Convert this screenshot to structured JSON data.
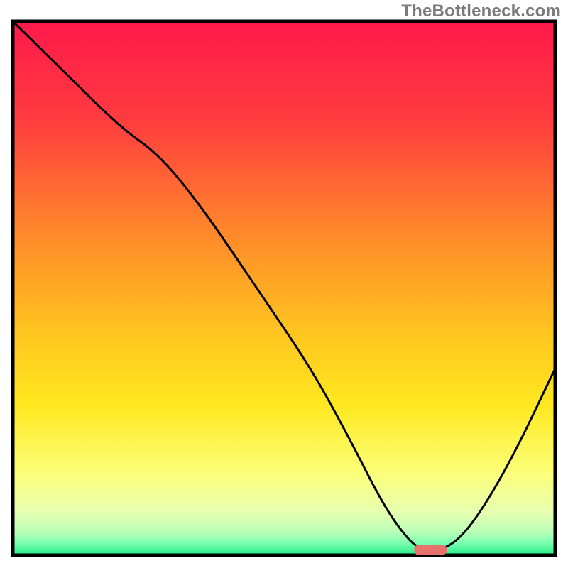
{
  "watermark": "TheBottleneck.com",
  "chart_data": {
    "type": "line",
    "title": "",
    "xlabel": "",
    "ylabel": "",
    "xlim": [
      0,
      100
    ],
    "ylim": [
      0,
      100
    ],
    "grid": false,
    "background_gradient": {
      "stops": [
        {
          "offset": 0,
          "color": "#ff1a4b"
        },
        {
          "offset": 18,
          "color": "#ff3b3f"
        },
        {
          "offset": 40,
          "color": "#ff8a2a"
        },
        {
          "offset": 58,
          "color": "#ffc41f"
        },
        {
          "offset": 72,
          "color": "#ffe81f"
        },
        {
          "offset": 85,
          "color": "#fbff7a"
        },
        {
          "offset": 92,
          "color": "#e8ffb0"
        },
        {
          "offset": 96,
          "color": "#b8ffb8"
        },
        {
          "offset": 98,
          "color": "#7affb0"
        },
        {
          "offset": 100,
          "color": "#2bf08a"
        }
      ]
    },
    "series": [
      {
        "name": "bottleneck-curve",
        "x": [
          0,
          10,
          20,
          27,
          35,
          45,
          55,
          62,
          68,
          72,
          75,
          80,
          85,
          92,
          100
        ],
        "y": [
          100,
          90,
          80,
          75,
          65,
          50,
          35,
          22,
          10,
          4,
          1,
          1,
          6,
          18,
          35
        ]
      }
    ],
    "marker": {
      "name": "highlight-range",
      "x_start": 74,
      "x_end": 80,
      "y": 1,
      "color": "#e9716b"
    }
  }
}
